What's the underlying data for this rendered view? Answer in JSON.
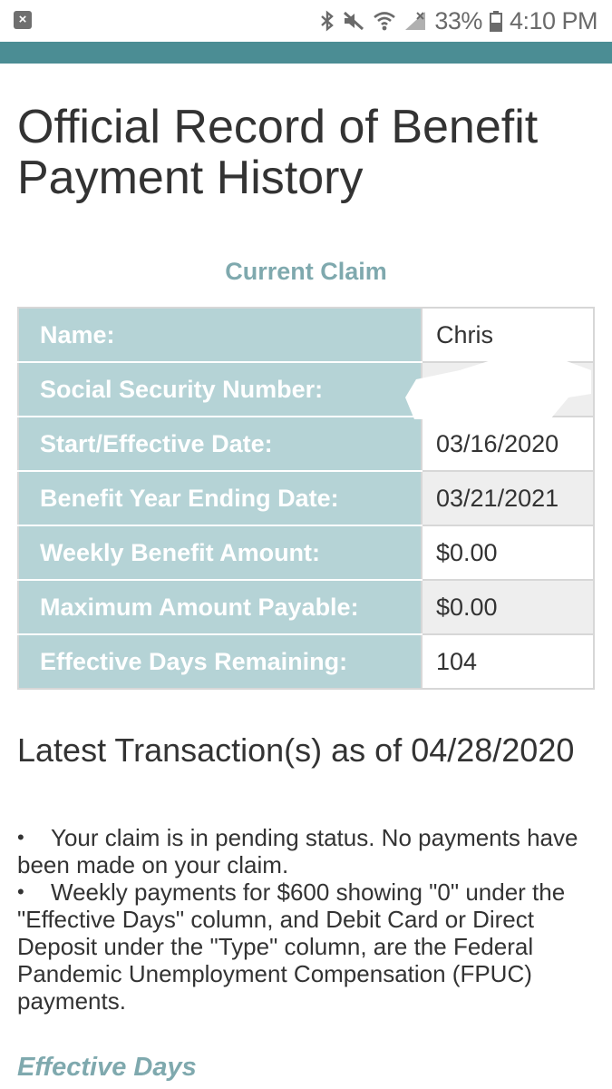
{
  "status_bar": {
    "battery_percent": "33%",
    "time": "4:10 PM",
    "icons": [
      "bluetooth-icon",
      "mute-icon",
      "wifi-icon",
      "cell-signal-icon",
      "battery-icon"
    ]
  },
  "accent_color": "#4b8d94",
  "page_title": "Official Record of Benefit Payment History",
  "current_claim": {
    "heading": "Current Claim",
    "rows": [
      {
        "label": "Name:",
        "value": "Chris"
      },
      {
        "label": "Social Security Number:",
        "value": ""
      },
      {
        "label": "Start/Effective Date:",
        "value": "03/16/2020"
      },
      {
        "label": "Benefit Year Ending Date:",
        "value": "03/21/2021"
      },
      {
        "label": "Weekly Benefit Amount:",
        "value": "$0.00"
      },
      {
        "label": "Maximum Amount Payable:",
        "value": "$0.00"
      },
      {
        "label": "Effective Days Remaining:",
        "value": "104"
      }
    ]
  },
  "latest_transactions": {
    "heading": "Latest Transaction(s) as of 04/28/2020",
    "items": [
      "Your claim is in pending status. No payments have been made on your claim.",
      "Weekly payments for $600 showing \"0\" under the \"Effective Days\" column, and Debit Card or Direct Deposit under the \"Type\" column, are the Federal Pandemic Unemployment Compensation (FPUC) payments."
    ]
  },
  "effective_days_heading": "Effective Days"
}
